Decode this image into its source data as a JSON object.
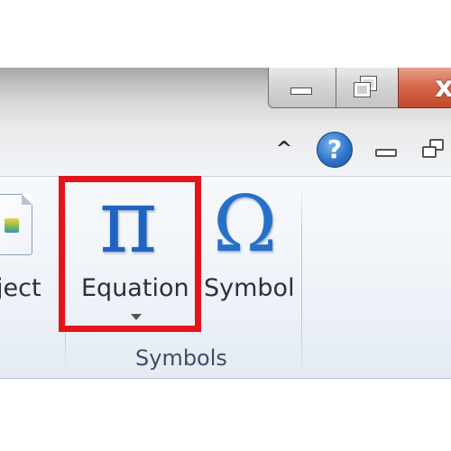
{
  "window": {
    "close_glyph": "x",
    "minimize_icon": "minimize-icon",
    "restore_icon": "restore-icon"
  },
  "ribbon_controls": {
    "collapse_glyph": "^",
    "help_glyph": "?"
  },
  "ribbon": {
    "object_label": "ject",
    "equation_glyph": "π",
    "equation_label": "Equation",
    "symbol_glyph": "Ω",
    "symbol_label": "Symbol",
    "group_label": "Symbols"
  },
  "colors": {
    "highlight": "#e4141b",
    "icon_blue": "#1f64c4",
    "close_red": "#c3482b"
  }
}
